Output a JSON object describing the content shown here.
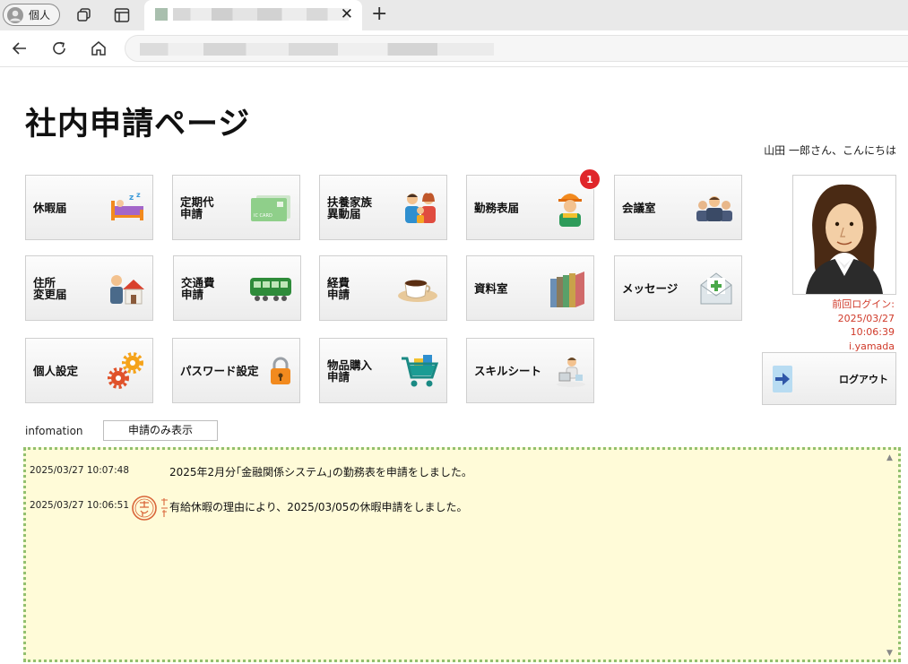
{
  "browser": {
    "profile_label": "個人",
    "colors": {
      "tabbar": "#e9e9e9",
      "accent": "#d03a2a"
    }
  },
  "page": {
    "title": "社内申請ページ",
    "greeting": "山田 一郎さん、こんにちは"
  },
  "tiles": [
    {
      "label": "休暇届",
      "icon": "bed-icon"
    },
    {
      "label": "定期代\n申請",
      "icon": "ic-card-icon"
    },
    {
      "label": "扶養家族\n異動届",
      "icon": "family-icon"
    },
    {
      "label": "勤務表届",
      "icon": "worker-icon",
      "badge": "1"
    },
    {
      "label": "会議室",
      "icon": "meeting-icon"
    },
    {
      "label": "住所\n変更届",
      "icon": "house-icon"
    },
    {
      "label": "交通費\n申請",
      "icon": "train-icon"
    },
    {
      "label": "経費\n申請",
      "icon": "coffee-icon"
    },
    {
      "label": "資料室",
      "icon": "books-icon"
    },
    {
      "label": "メッセージ",
      "icon": "envelope-icon"
    },
    {
      "label": "個人設定",
      "icon": "gears-icon"
    },
    {
      "label": "パスワード設定",
      "icon": "lock-icon"
    },
    {
      "label": "物品購入\n申請",
      "icon": "cart-icon"
    },
    {
      "label": "スキルシート",
      "icon": "skill-sheet-icon"
    }
  ],
  "user": {
    "last_login_label": "前回ログイン:",
    "last_login_date": "2025/03/27",
    "last_login_time": "10:06:39",
    "user_id": "i.yamada",
    "logout_label": "ログアウト"
  },
  "info": {
    "label": "infomation",
    "filter_button": "申請のみ表示",
    "messages": [
      {
        "timestamp": "2025/03/27 10:07:48",
        "text": "2025年2月分｢金融関係システム｣の勤務表を申請をしました。"
      },
      {
        "timestamp": "2025/03/27 10:06:51",
        "text": "有給休暇の理由により、2025/03/05の休暇申請をしました。",
        "stamp": "approval-stamp-icon"
      }
    ]
  }
}
